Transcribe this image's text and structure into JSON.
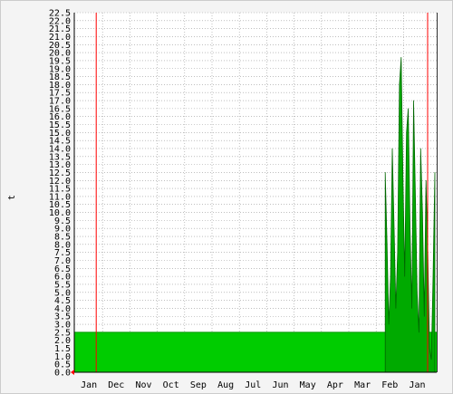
{
  "chart_data": {
    "type": "area",
    "title": "",
    "xlabel": "",
    "ylabel": "t",
    "ylim": [
      0,
      22.5
    ],
    "y_tick_step": 0.5,
    "grid": true,
    "x_tick_labels": [
      "Jan",
      "Dec",
      "Nov",
      "Oct",
      "Sep",
      "Aug",
      "Jul",
      "Jun",
      "May",
      "Apr",
      "Mar",
      "Feb",
      "Jan"
    ],
    "x_axis_note": "time runs right-to-left from Jan (older) to Jan (newer) over about 13 months",
    "baseline_series": {
      "name": "",
      "color": "#00cc00",
      "level": 2.5,
      "from": "Jan",
      "to": "end"
    },
    "spike_series": {
      "name": "",
      "color": "#006600",
      "fill": "#00aa00",
      "points": [
        [
          "Feb",
          12.5
        ],
        [
          "Feb",
          8.0
        ],
        [
          "Feb",
          3.0
        ],
        [
          "Feb",
          6.0
        ],
        [
          "Feb",
          14.0
        ],
        [
          "Feb",
          9.0
        ],
        [
          "Feb",
          4.0
        ],
        [
          "Feb",
          7.5
        ],
        [
          "Feb",
          18.0
        ],
        [
          "Feb",
          19.7
        ],
        [
          "Feb",
          12.0
        ],
        [
          "Feb",
          6.0
        ],
        [
          "Feb",
          15.0
        ],
        [
          "Feb",
          16.5
        ],
        [
          "Feb",
          9.0
        ],
        [
          "Feb",
          4.0
        ],
        [
          "Feb",
          17.0
        ],
        [
          "Jan",
          11.0
        ],
        [
          "Jan",
          5.0
        ],
        [
          "Jan",
          2.5
        ],
        [
          "Jan",
          14.0
        ],
        [
          "Jan",
          10.0
        ],
        [
          "Jan",
          3.5
        ],
        [
          "Jan",
          12.0
        ],
        [
          "Jan",
          7.5
        ],
        [
          "Jan",
          1.5
        ],
        [
          "Jan",
          0.8
        ],
        [
          "Jan",
          6.0
        ],
        [
          "Jan",
          12.5
        ]
      ]
    },
    "vertical_markers": [
      {
        "name": "",
        "color": "#ff0000",
        "at": "Dec"
      },
      {
        "name": "",
        "color": "#ff0000",
        "at": "Jan-end"
      }
    ],
    "colors": {
      "grid": "#999999",
      "axis": "#000000",
      "background": "#ffffff",
      "outer_background": "#f4f4f4",
      "frame": "#cccccc",
      "marker": "#ff0000"
    }
  }
}
